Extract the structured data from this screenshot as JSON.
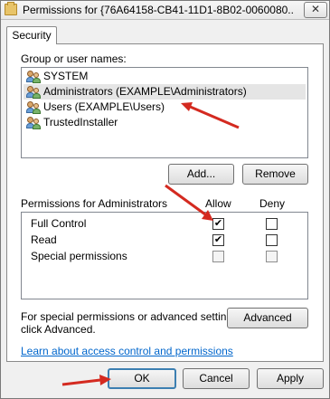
{
  "window": {
    "title": "Permissions for {76A64158-CB41-11D1-8B02-0060080...",
    "close_symbol": "✕"
  },
  "tabs": [
    {
      "label": "Security",
      "active": true
    }
  ],
  "group_section": {
    "label": "Group or user names:",
    "items": [
      {
        "label": "SYSTEM",
        "selected": false,
        "icon": "users-icon"
      },
      {
        "label": "Administrators (EXAMPLE\\Administrators)",
        "selected": true,
        "icon": "users-icon"
      },
      {
        "label": "Users (EXAMPLE\\Users)",
        "selected": false,
        "icon": "users-icon"
      },
      {
        "label": "TrustedInstaller",
        "selected": false,
        "icon": "users-icon"
      }
    ]
  },
  "buttons": {
    "add": "Add...",
    "remove": "Remove",
    "advanced": "Advanced",
    "ok": "OK",
    "cancel": "Cancel",
    "apply": "Apply"
  },
  "permissions": {
    "label": "Permissions for Administrators",
    "allow_header": "Allow",
    "deny_header": "Deny",
    "rows": [
      {
        "name": "Full Control",
        "allow": true,
        "deny": false,
        "disabled": false
      },
      {
        "name": "Read",
        "allow": true,
        "deny": false,
        "disabled": false
      },
      {
        "name": "Special permissions",
        "allow": false,
        "deny": false,
        "disabled": true
      }
    ]
  },
  "advanced_note": {
    "line1": "For special permissions or advanced settings,",
    "line2": "click Advanced."
  },
  "help_link": "Learn about access control and permissions",
  "checkmark": "✔",
  "colors": {
    "annotation_arrow": "#d42a20",
    "link": "#0066cc",
    "default_button_border": "#3c7fb1"
  }
}
